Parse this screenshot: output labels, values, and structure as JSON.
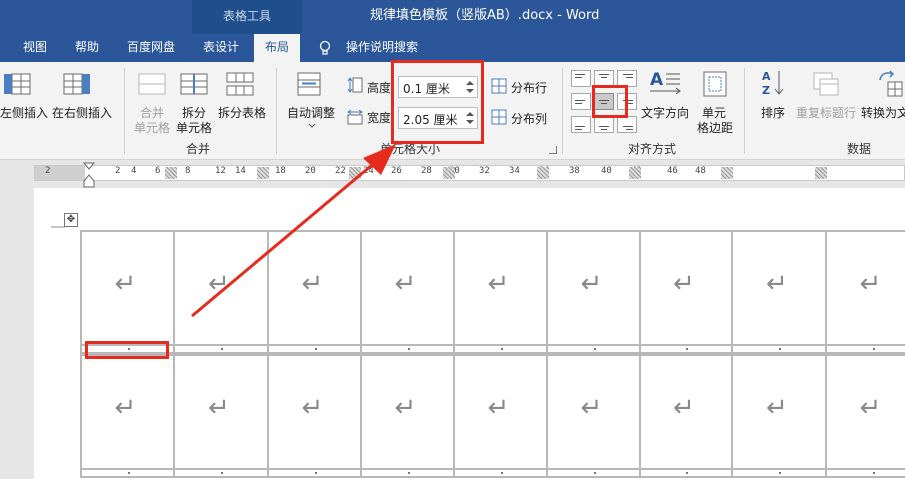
{
  "titlebar": {
    "context_tab": "表格工具",
    "doc_title": "规律填色模板（竖版AB）.docx  -  Word"
  },
  "tabs": [
    {
      "label": "视图"
    },
    {
      "label": "帮助"
    },
    {
      "label": "百度网盘"
    },
    {
      "label": "表设计"
    },
    {
      "label": "布局"
    },
    {
      "label": "操作说明搜索"
    }
  ],
  "ribbon": {
    "insert_left": "左侧插入",
    "insert_right": "在右侧插入",
    "merge_cells_line1": "合并",
    "merge_cells_line2": "单元格",
    "split_cells_line1": "拆分",
    "split_cells_line2": "单元格",
    "split_table": "拆分表格",
    "merge_group": "合并",
    "autofit": "自动调整",
    "height_label": "高度",
    "height_value": "0.1 厘米",
    "width_label": "宽度",
    "width_value": "2.05 厘米",
    "distribute_rows": "分布行",
    "distribute_cols": "分布列",
    "cell_size_group": "单元格大小",
    "text_direction": "文字方向",
    "cell_margins_line1": "单元",
    "cell_margins_line2": "格边距",
    "alignment_group": "对齐方式",
    "sort": "排序",
    "repeat_header": "重复标题行",
    "convert_to_text": "转换为文",
    "data_group": "数据"
  },
  "ruler": {
    "labels": [
      "2",
      "2",
      "4",
      "6",
      "8",
      "12",
      "14",
      "18",
      "20",
      "22",
      "24",
      "26",
      "28",
      "30",
      "32",
      "34",
      "36",
      "38",
      "40",
      "42",
      "46",
      "48"
    ]
  },
  "colors": {
    "brand": "#2b579a",
    "annotation": "#e62b1e"
  }
}
